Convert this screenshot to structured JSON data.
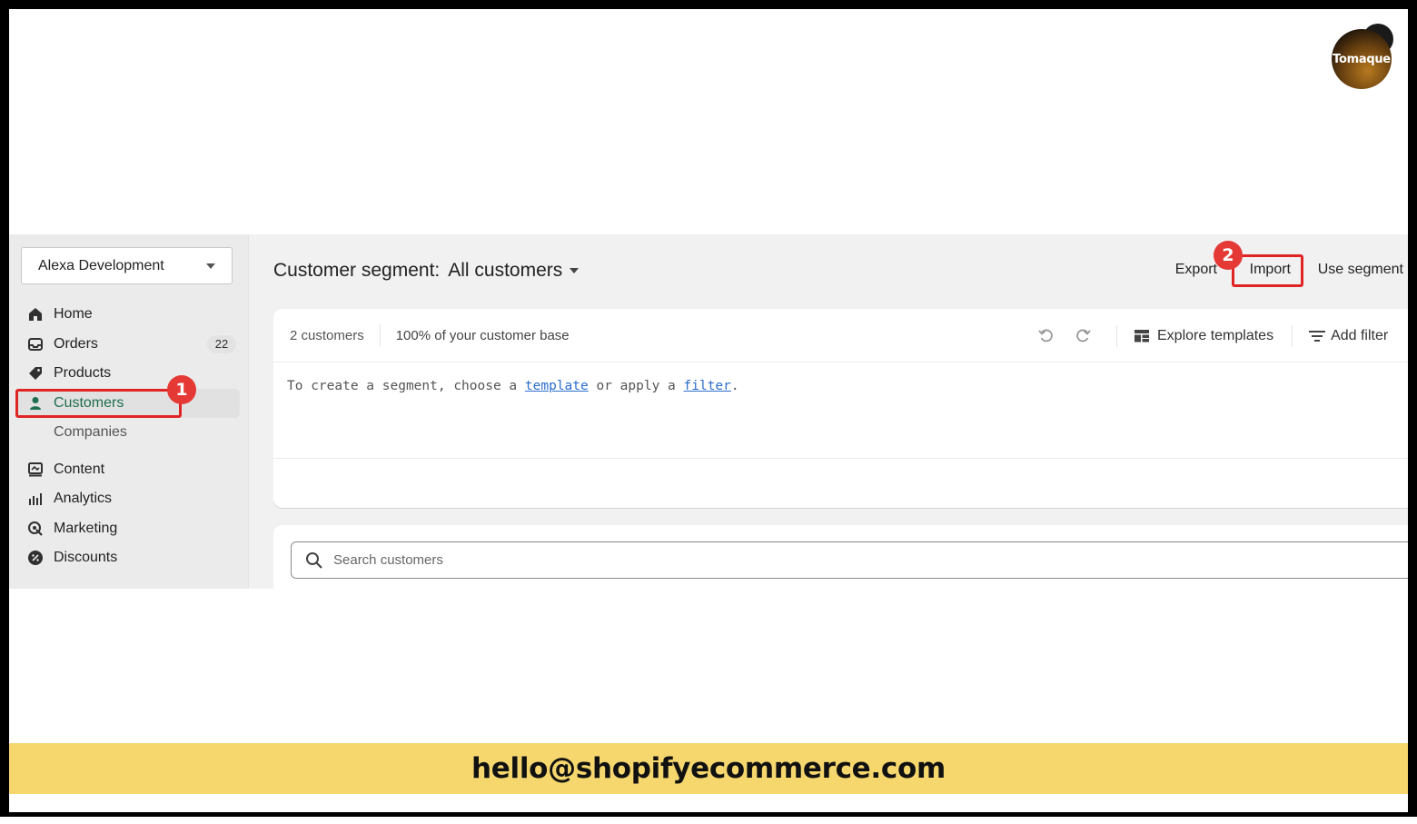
{
  "branding": {
    "logo_text": "Tomaque"
  },
  "sidebar": {
    "store_name": "Alexa Development",
    "items": [
      {
        "label": "Home",
        "icon": "home-icon"
      },
      {
        "label": "Orders",
        "icon": "orders-icon",
        "badge": "22"
      },
      {
        "label": "Products",
        "icon": "tag-icon"
      },
      {
        "label": "Customers",
        "icon": "person-icon",
        "active": true
      },
      {
        "label": "Companies"
      },
      {
        "label": "Content",
        "icon": "content-icon"
      },
      {
        "label": "Analytics",
        "icon": "analytics-icon"
      },
      {
        "label": "Marketing",
        "icon": "marketing-icon"
      },
      {
        "label": "Discounts",
        "icon": "discount-icon"
      }
    ]
  },
  "annotations": {
    "step1": "1",
    "step2": "2",
    "highlight_color": "#e02424"
  },
  "header": {
    "title_prefix": "Customer segment:",
    "title_segment": "All customers",
    "actions": {
      "export": "Export",
      "import": "Import",
      "use_segment": "Use segment"
    }
  },
  "segment": {
    "count": "2 customers",
    "percent": "100% of your customer base",
    "explore_templates": "Explore templates",
    "add_filter": "Add filter",
    "editor": {
      "part1": "To create a segment, choose a ",
      "link1": "template",
      "part2": " or apply a ",
      "link2": "filter",
      "part3": "."
    }
  },
  "search": {
    "placeholder": "Search customers"
  },
  "contact": {
    "email": "hello@shopifyecommerce.com"
  },
  "colors": {
    "accent_green": "#1f6e4f",
    "link_blue": "#2c6ecb",
    "banner_yellow": "#f5d76e"
  }
}
